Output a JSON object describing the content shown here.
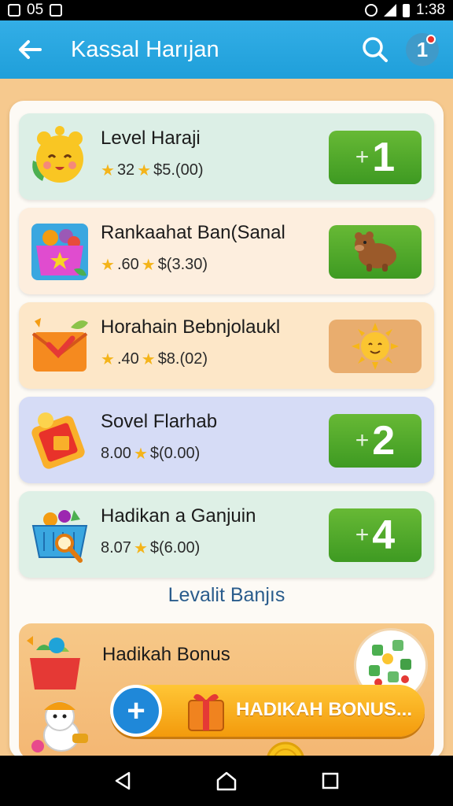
{
  "status_bar": {
    "left_text": "05",
    "time": "1:38"
  },
  "app_bar": {
    "title": "Kassal Harıjan",
    "notification_label": "1"
  },
  "cards": [
    {
      "title": "Level Haraji",
      "meta_a": "32",
      "meta_b": "$5.(00)",
      "action_label": "1",
      "action_type": "green",
      "bg": "#dcefe6"
    },
    {
      "title": "Rankaahat Ban(Sanal",
      "meta_a": ".60",
      "meta_b": "$(3.30)",
      "action_label": "",
      "action_type": "green",
      "bg": "#fdeede"
    },
    {
      "title": "Horahain Bebnjolaukl",
      "meta_a": ".40",
      "meta_b": "$8.(02)",
      "action_label": "",
      "action_type": "tan",
      "bg": "#fde7c8"
    },
    {
      "title": "Sovel Flarhab",
      "meta_a": "8.00",
      "meta_b": "$(0.00)",
      "action_label": "2",
      "action_type": "green",
      "bg": "#d6dcf6"
    },
    {
      "title": "Hadikan a Ganjuin",
      "meta_a": "8.07",
      "meta_b": "$(6.00)",
      "action_label": "4",
      "action_type": "green",
      "bg": "#def0e6"
    }
  ],
  "section_title": "Levalit Banjıs",
  "bonus": {
    "title": "Hadikah Bonus",
    "button_label": "HADIKAH BONUS..."
  },
  "colors": {
    "app_bar": "#1f9fda",
    "green_button": "#4aa62a",
    "bonus_button": "#f7a81a",
    "section_title": "#2a5c8c"
  }
}
